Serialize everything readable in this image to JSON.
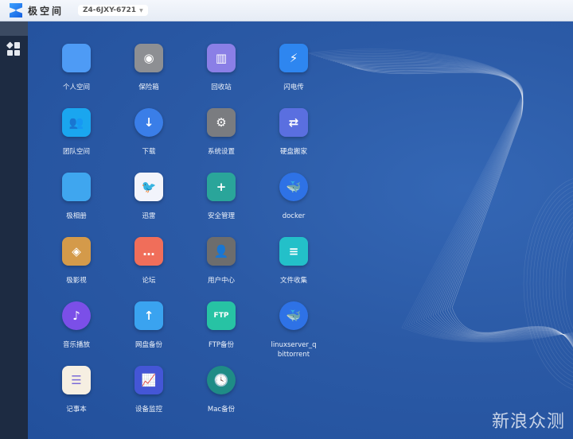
{
  "topbar": {
    "brand": "极空间",
    "device": "Z4-6JXY-6721"
  },
  "apps": [
    {
      "label": "个人空间",
      "icon": "folder-icon",
      "glyph": "",
      "color": "#4e9bf5"
    },
    {
      "label": "保险箱",
      "icon": "safe-icon",
      "glyph": "◉",
      "color": "#8d8f93"
    },
    {
      "label": "回收站",
      "icon": "trash-icon",
      "glyph": "▥",
      "color": "#8a7fe6"
    },
    {
      "label": "闪电传",
      "icon": "lightning-icon",
      "glyph": "⚡",
      "color": "#2e86f0"
    },
    {
      "label": "团队空间",
      "icon": "team-folder-icon",
      "glyph": "👥",
      "color": "#1aa6ef"
    },
    {
      "label": "下载",
      "icon": "download-globe-icon",
      "glyph": "↓",
      "color": "#3a7ee8"
    },
    {
      "label": "系统设置",
      "icon": "gear-icon",
      "glyph": "⚙",
      "color": "#7a7c80"
    },
    {
      "label": "硬盘搬家",
      "icon": "disk-move-icon",
      "glyph": "⇄",
      "color": "#5a6fe0"
    },
    {
      "label": "极相册",
      "icon": "photo-icon",
      "glyph": "",
      "color": "#3fa6ef"
    },
    {
      "label": "迅雷",
      "icon": "thunder-bird-icon",
      "glyph": "🐦",
      "color": "#f2f4fb"
    },
    {
      "label": "安全管理",
      "icon": "shield-icon",
      "glyph": "+",
      "color": "#2aa59a"
    },
    {
      "label": "docker",
      "icon": "docker-icon",
      "glyph": "🐳",
      "color": "#2e72e6"
    },
    {
      "label": "极影视",
      "icon": "video-icon",
      "glyph": "◈",
      "color": "#d49a4a"
    },
    {
      "label": "论坛",
      "icon": "forum-icon",
      "glyph": "…",
      "color": "#f06e5a"
    },
    {
      "label": "用户中心",
      "icon": "user-icon",
      "glyph": "👤",
      "color": "#6d6d6d"
    },
    {
      "label": "文件收集",
      "icon": "file-collect-icon",
      "glyph": "≡",
      "color": "#23c0c9"
    },
    {
      "label": "音乐播放",
      "icon": "music-icon",
      "glyph": "♪",
      "color": "#7b4fe8"
    },
    {
      "label": "网盘备份",
      "icon": "cloud-upload-icon",
      "glyph": "↑",
      "color": "#3aa3f0"
    },
    {
      "label": "FTP备份",
      "icon": "ftp-icon",
      "glyph": "FTP",
      "color": "#27c3a4"
    },
    {
      "label": "linuxserver_q bittorrent",
      "icon": "docker-icon",
      "glyph": "🐳",
      "color": "#2e72e6"
    },
    {
      "label": "记事本",
      "icon": "notepad-icon",
      "glyph": "☰",
      "color": "#f6efe2"
    },
    {
      "label": "设备监控",
      "icon": "monitor-chart-icon",
      "glyph": "📈",
      "color": "#4456d6"
    },
    {
      "label": "Mac备份",
      "icon": "time-machine-icon",
      "glyph": "🕓",
      "color": "#1f8c86"
    }
  ],
  "watermark": "新浪众测"
}
